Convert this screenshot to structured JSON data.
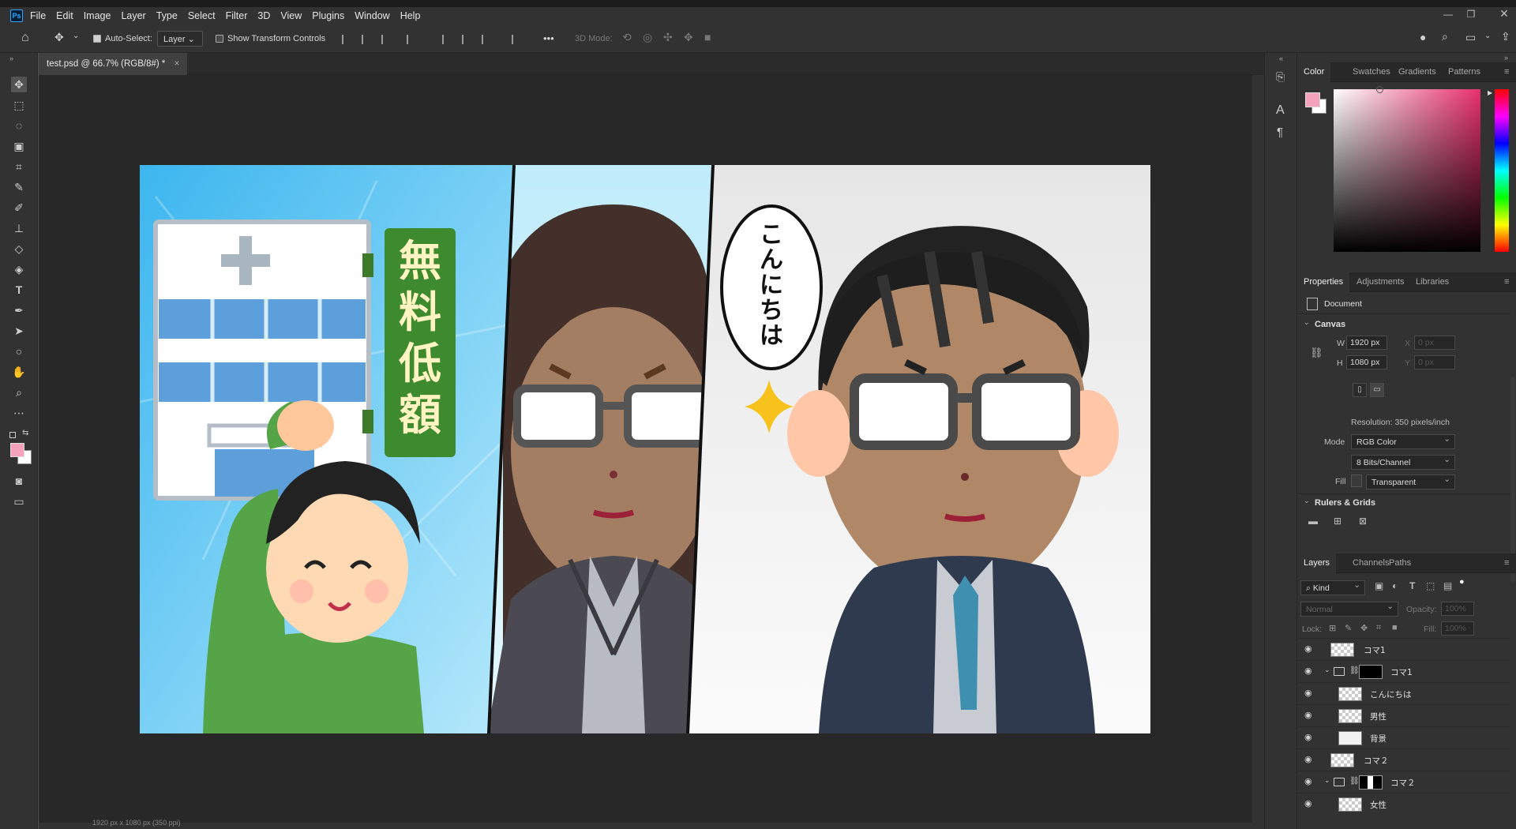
{
  "app": {
    "logo": "Ps"
  },
  "menu": [
    "File",
    "Edit",
    "Image",
    "Layer",
    "Type",
    "Select",
    "Filter",
    "3D",
    "View",
    "Plugins",
    "Window",
    "Help"
  ],
  "window_controls": {
    "minimize": "—",
    "restore": "❐",
    "close": "✕"
  },
  "options": {
    "auto_select_label": "Auto-Select:",
    "auto_select_checked": true,
    "auto_select_target": "Layer",
    "show_transform_label": "Show Transform Controls",
    "show_transform_checked": false,
    "more": "•••",
    "mode_3d_label": "3D Mode:"
  },
  "document_tab": {
    "title": "test.psd @ 66.7% (RGB/8#) *",
    "close": "×"
  },
  "colors": {
    "foreground": "#f5a3bd",
    "background": "#ffffff",
    "hue": "#e8306e"
  },
  "canvas": {
    "speech_bubble": [
      "こ",
      "ん",
      "に",
      "ち",
      "は"
    ],
    "sign": [
      "無",
      "料",
      "低",
      "額"
    ]
  },
  "color_panel": {
    "tabs": [
      "Color",
      "Swatches",
      "Gradients",
      "Patterns"
    ],
    "active": "Color"
  },
  "properties_panel": {
    "tabs": [
      "Properties",
      "Adjustments",
      "Libraries"
    ],
    "active": "Properties",
    "doc_label": "Document",
    "canvas_section": "Canvas",
    "w_label": "W",
    "w_value": "1920 px",
    "h_label": "H",
    "h_value": "1080 px",
    "x_label": "X",
    "x_value": "0 px",
    "y_label": "Y",
    "y_value": "0 px",
    "resolution": "Resolution: 350 pixels/inch",
    "mode_label": "Mode",
    "mode_value": "RGB Color",
    "bits_value": "8 Bits/Channel",
    "fill_label": "Fill",
    "fill_value": "Transparent",
    "rulers_section": "Rulers & Grids"
  },
  "layers_panel": {
    "tabs": [
      "Layers",
      "Channels",
      "Paths"
    ],
    "active": "Layers",
    "kind": "Kind",
    "blend": "Normal",
    "opacity_label": "Opacity:",
    "opacity_value": "100%",
    "lock_label": "Lock:",
    "fill_label": "Fill:",
    "fill_value": "100%",
    "layers": [
      {
        "name": "コマ1",
        "type": "layer",
        "indent": 0
      },
      {
        "name": "コマ1",
        "type": "group",
        "indent": 0
      },
      {
        "name": "こんにちは",
        "type": "layer",
        "indent": 1
      },
      {
        "name": "男性",
        "type": "layer",
        "indent": 1
      },
      {
        "name": "背景",
        "type": "layer",
        "indent": 1
      },
      {
        "name": "コマ２",
        "type": "layer",
        "indent": 0
      },
      {
        "name": "コマ２",
        "type": "group",
        "indent": 0
      },
      {
        "name": "女性",
        "type": "layer",
        "indent": 1
      }
    ]
  },
  "status": {
    "doc_size": "1920 px x 1080 px (350 ppi)"
  }
}
